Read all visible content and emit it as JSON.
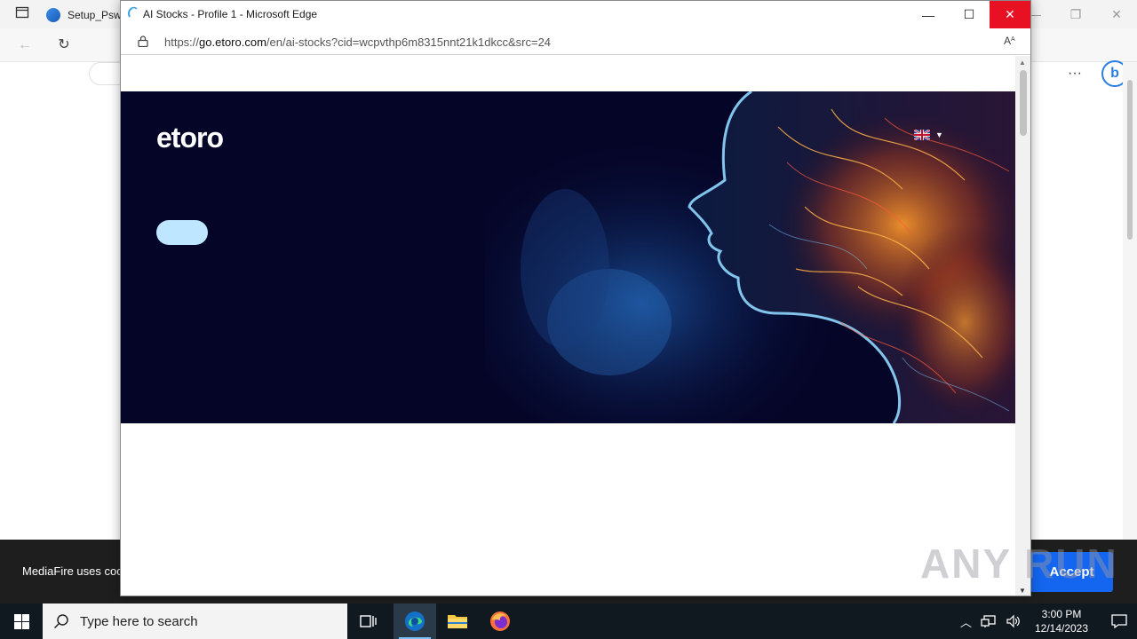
{
  "background_browser": {
    "tab_title": "Setup_Psw",
    "cookie_text": "MediaFire uses coo",
    "accept_label": "Accept"
  },
  "popup": {
    "title": "AI Stocks - Profile 1 - Microsoft Edge",
    "url_prefix": "https://",
    "url_host": "go.etoro.com",
    "url_path": "/en/ai-stocks?cid=wcpvthp6m8315nnt21k1dkcc&src=24",
    "read_aloud": "Aᴬ",
    "controls": {
      "minimize": "—",
      "maximize": "☐",
      "close": "✕"
    }
  },
  "hero": {
    "logo_text": "etoro",
    "language": "EN",
    "colors": {
      "background": "#050528",
      "cta": "#bfe6ff"
    }
  },
  "watermark": "ANY RUN",
  "taskbar": {
    "search_placeholder": "Type here to search",
    "time": "3:00 PM",
    "date": "12/14/2023",
    "apps": [
      "task-view",
      "microsoft-edge",
      "file-explorer",
      "firefox"
    ]
  }
}
